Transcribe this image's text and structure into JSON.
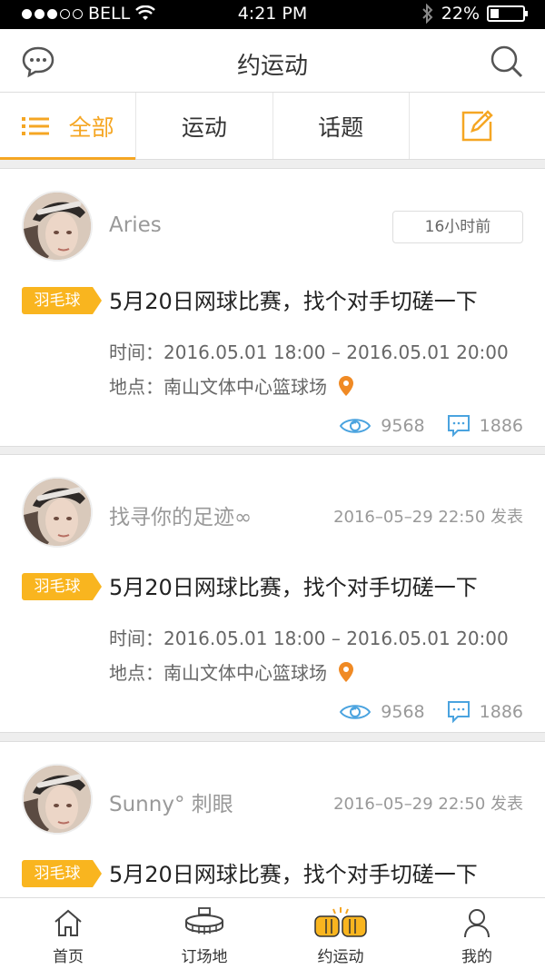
{
  "status_bar": {
    "carrier": "BELL",
    "time": "4:21 PM",
    "battery": "22%"
  },
  "nav": {
    "title": "约运动",
    "left_icon": "chat-icon",
    "right_icon": "search-icon"
  },
  "tabs": [
    {
      "label": "全部",
      "active": true
    },
    {
      "label": "运动",
      "active": false
    },
    {
      "label": "话题",
      "active": false
    },
    {
      "label": "",
      "icon": "edit-icon"
    }
  ],
  "posts": [
    {
      "name": "Aries",
      "time_badge": "16小时前",
      "tag": "羽毛球",
      "title": "5月20日网球比赛，找个对手切磋一下",
      "time": "时间：2016.05.01 18:00 – 2016.05.01 20:00",
      "location": "地点：南山文体中心篮球场",
      "views": "9568",
      "comments": "1886"
    },
    {
      "name": "找寻你的足迹∞",
      "posted": "2016–05–29   22:50 发表",
      "tag": "羽毛球",
      "title": "5月20日网球比赛，找个对手切磋一下",
      "time": "时间：2016.05.01 18:00 – 2016.05.01 20:00",
      "location": "地点：南山文体中心篮球场",
      "views": "9568",
      "comments": "1886"
    },
    {
      "name": "Sunny°  刺眼",
      "posted": "2016–05–29   22:50 发表",
      "tag": "羽毛球",
      "title": "5月20日网球比赛，找个对手切磋一下"
    }
  ],
  "tabbar": [
    {
      "label": "首页",
      "icon": "home-icon"
    },
    {
      "label": "订场地",
      "icon": "stadium-icon"
    },
    {
      "label": "约运动",
      "icon": "fist-bump-icon",
      "active": true
    },
    {
      "label": "我的",
      "icon": "person-icon"
    }
  ],
  "colors": {
    "accent": "#f5a623",
    "tag": "#f9b51f",
    "link_blue": "#4aa3df",
    "location_pin": "#f08a24"
  }
}
